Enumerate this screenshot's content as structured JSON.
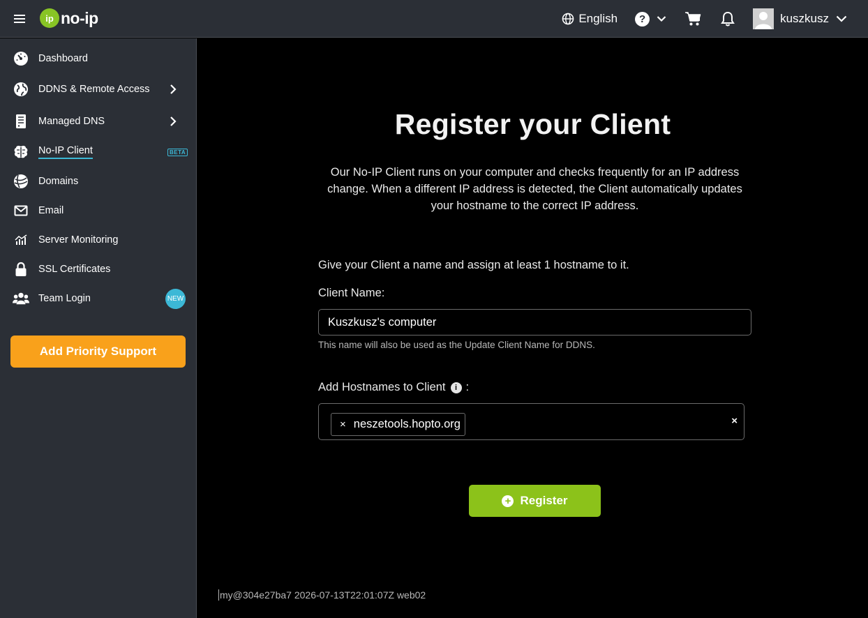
{
  "header": {
    "logo_text": "no-ip",
    "logo_mark": "ip",
    "language": "English",
    "help_symbol": "?",
    "username": "kuszkusz"
  },
  "sidebar": {
    "items": [
      {
        "label": "Dashboard",
        "icon": "dashboard-gauge-icon"
      },
      {
        "label": "DDNS & Remote Access",
        "icon": "globe-icon"
      },
      {
        "label": "Managed DNS",
        "icon": "server-icon"
      },
      {
        "label": "No-IP Client",
        "icon": "brain-icon",
        "badge": "BETA",
        "active": true
      },
      {
        "label": "Domains",
        "icon": "globe-lines-icon"
      },
      {
        "label": "Email",
        "icon": "envelope-icon"
      },
      {
        "label": "Server Monitoring",
        "icon": "chart-icon"
      },
      {
        "label": "SSL Certificates",
        "icon": "lock-icon"
      },
      {
        "label": "Team Login",
        "icon": "users-icon",
        "badge": "NEW"
      }
    ],
    "priority_button": "Add Priority Support"
  },
  "main": {
    "title": "Register your Client",
    "description": "Our No-IP Client runs on your computer and checks frequently for an IP address change. When a different IP address is detected, the Client automatically updates your hostname to the correct IP address.",
    "instruction": "Give your Client a name and assign at least 1 hostname to it.",
    "client_name_label": "Client Name:",
    "client_name_value": "Kuszkusz's computer",
    "client_name_help": "This name will also be used as the Update Client Name for DDNS.",
    "hostnames_label": "Add Hostnames to Client",
    "hostnames_colon": ":",
    "hostname_tags": [
      "neszetools.hopto.org"
    ],
    "tag_remove": "×",
    "clear_all": "×",
    "register_button": "Register",
    "footer": "my@304e27ba7 2026-07-13T22:01:07Z web02"
  },
  "colors": {
    "accent_green": "#8cc21a",
    "priority_orange": "#f9a11b",
    "accent_cyan": "#3cb8d6",
    "panel_bg": "#2b2f36"
  }
}
